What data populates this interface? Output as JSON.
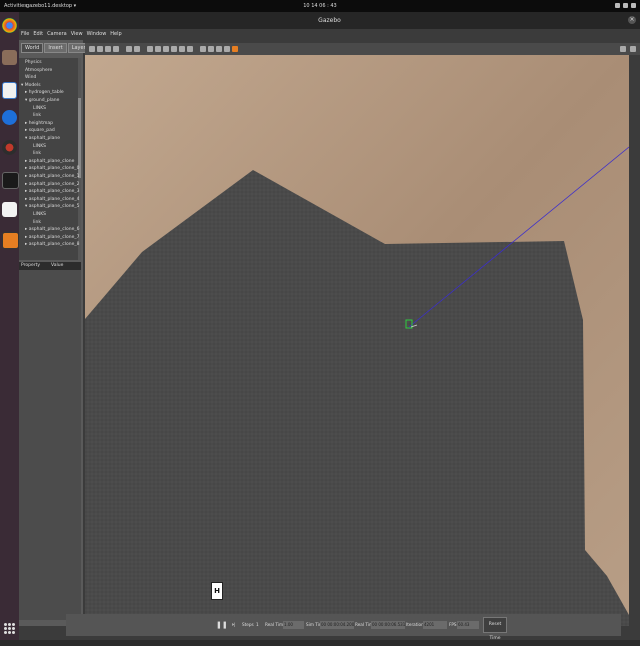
{
  "system_bar": {
    "activities": "Activities",
    "app_menu": "gazebo11.desktop ▾",
    "clock": "10 14 06 : 43"
  },
  "window": {
    "title": "Gazebo"
  },
  "menu": [
    "File",
    "Edit",
    "Camera",
    "View",
    "Window",
    "Help"
  ],
  "panel": {
    "tabs": [
      "World",
      "Insert",
      "Layers"
    ],
    "tree": [
      {
        "label": "Physics",
        "indent": 1
      },
      {
        "label": "Atmosphere",
        "indent": 1
      },
      {
        "label": "Wind",
        "indent": 1
      },
      {
        "label": "▾ Models",
        "indent": 0
      },
      {
        "label": "▸ hydrogen_table",
        "indent": 1
      },
      {
        "label": "▾ ground_plane",
        "indent": 1
      },
      {
        "label": "LINKS",
        "indent": 3
      },
      {
        "label": "link",
        "indent": 3
      },
      {
        "label": "▸ heightmap",
        "indent": 1
      },
      {
        "label": "▸ square_pad",
        "indent": 1
      },
      {
        "label": "▾ asphalt_plane",
        "indent": 1
      },
      {
        "label": "LINKS",
        "indent": 3
      },
      {
        "label": "link",
        "indent": 3
      },
      {
        "label": "▸ asphalt_plane_clone",
        "indent": 1
      },
      {
        "label": "▸ asphalt_plane_clone_0",
        "indent": 1
      },
      {
        "label": "▸ asphalt_plane_clone_1",
        "indent": 1
      },
      {
        "label": "▸ asphalt_plane_clone_2",
        "indent": 1
      },
      {
        "label": "▸ asphalt_plane_clone_3",
        "indent": 1
      },
      {
        "label": "▸ asphalt_plane_clone_4",
        "indent": 1
      },
      {
        "label": "▾ asphalt_plane_clone_5",
        "indent": 1
      },
      {
        "label": "LINKS",
        "indent": 3
      },
      {
        "label": "link",
        "indent": 3
      },
      {
        "label": "▸ asphalt_plane_clone_6",
        "indent": 1
      },
      {
        "label": "▸ asphalt_plane_clone_7",
        "indent": 1
      },
      {
        "label": "▸ asphalt_plane_clone_8",
        "indent": 1
      }
    ],
    "property_header": "Property",
    "value_header": "Value"
  },
  "scene": {
    "marker_label": "H",
    "colors": {
      "ground": "#b59a82",
      "asphalt": "#4a4a4a",
      "ray": "#3b2ecc",
      "origin_marker": "#2ecc40"
    }
  },
  "statusbar": {
    "pause_icon": "pause-icon",
    "steps_label": "Steps",
    "steps_value": "1",
    "rtf_label": "Real Time Factor",
    "rtf_value": "1.00",
    "sim_time_label": "Sim Time",
    "sim_time_value": "00 00:00:04.200",
    "real_time_label": "Real Time",
    "real_time_value": "00 00:00:06.531",
    "iterations_label": "Iterations",
    "iterations_value": "4201",
    "fps_label": "FPS",
    "fps_value": "60.43",
    "reset_label": "Reset Time"
  }
}
